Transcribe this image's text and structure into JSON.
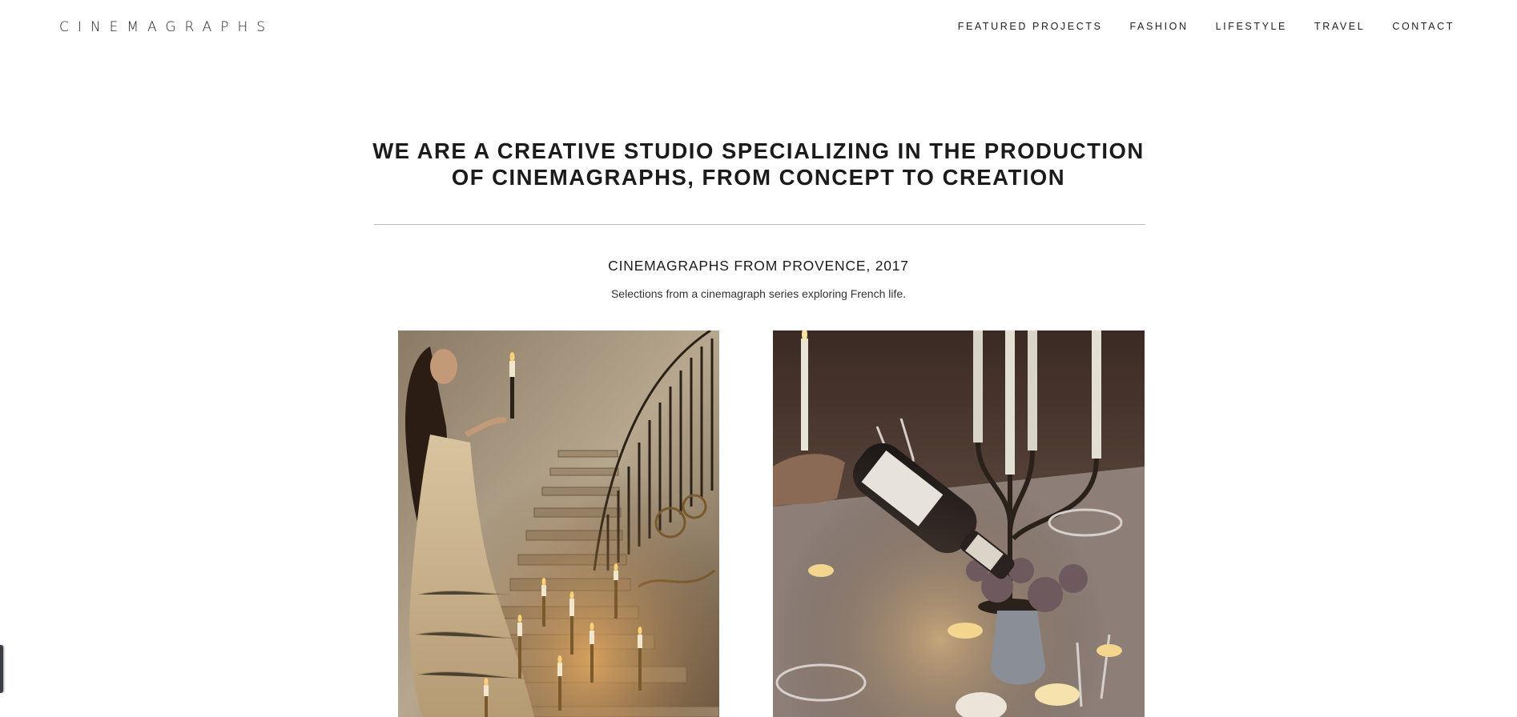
{
  "header": {
    "logo": "CINEMAGRAPHS",
    "nav": [
      {
        "label": "FEATURED PROJECTS"
      },
      {
        "label": "FASHION"
      },
      {
        "label": "LIFESTYLE"
      },
      {
        "label": "TRAVEL"
      },
      {
        "label": "CONTACT"
      }
    ]
  },
  "hero": {
    "line1": "WE ARE A CREATIVE STUDIO SPECIALIZING IN THE PRODUCTION",
    "line2": "OF CINEMAGRAPHS, FROM CONCEPT TO CREATION"
  },
  "section": {
    "title": "CINEMAGRAPHS FROM PROVENCE, 2017",
    "subtitle": "Selections from a cinemagraph series exploring French life."
  },
  "gallery": {
    "items": [
      {
        "icon": "photo-staircase-candles"
      },
      {
        "icon": "photo-dinner-table-wine"
      }
    ]
  },
  "colors": {
    "text": "#1b1b1b",
    "divider": "#bdbdbd",
    "background": "#ffffff"
  }
}
